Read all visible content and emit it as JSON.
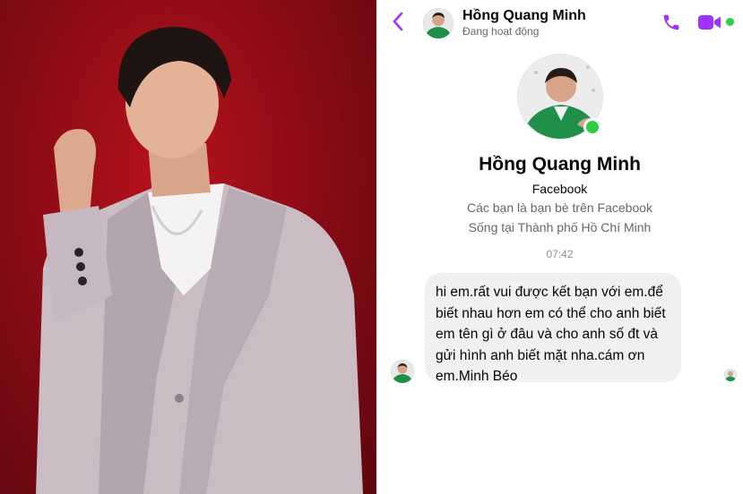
{
  "header": {
    "contact_name": "Hồng Quang Minh",
    "status": "Đang hoạt động"
  },
  "profile": {
    "name": "Hồng Quang Minh",
    "source": "Facebook",
    "friendship": "Các bạn là bạn bè trên Facebook",
    "location": "Sống tại Thành phố Hồ Chí Minh"
  },
  "conversation": {
    "timestamp": "07:42",
    "messages": [
      {
        "text": "hi em.rất vui được kết bạn với em.để biết nhau hơn em có thể cho anh biết em tên gì ở đâu và cho anh số đt và gửi hình anh biết mặt nha.cám ơn em.Minh Béo"
      }
    ]
  },
  "icons": {
    "back": "chevron-left-icon",
    "call": "phone-icon",
    "video": "video-camera-icon"
  },
  "colors": {
    "accent": "#a033ff",
    "online": "#31cc46",
    "bubble": "#f0f0f0",
    "photo_background": "#a0101a"
  }
}
